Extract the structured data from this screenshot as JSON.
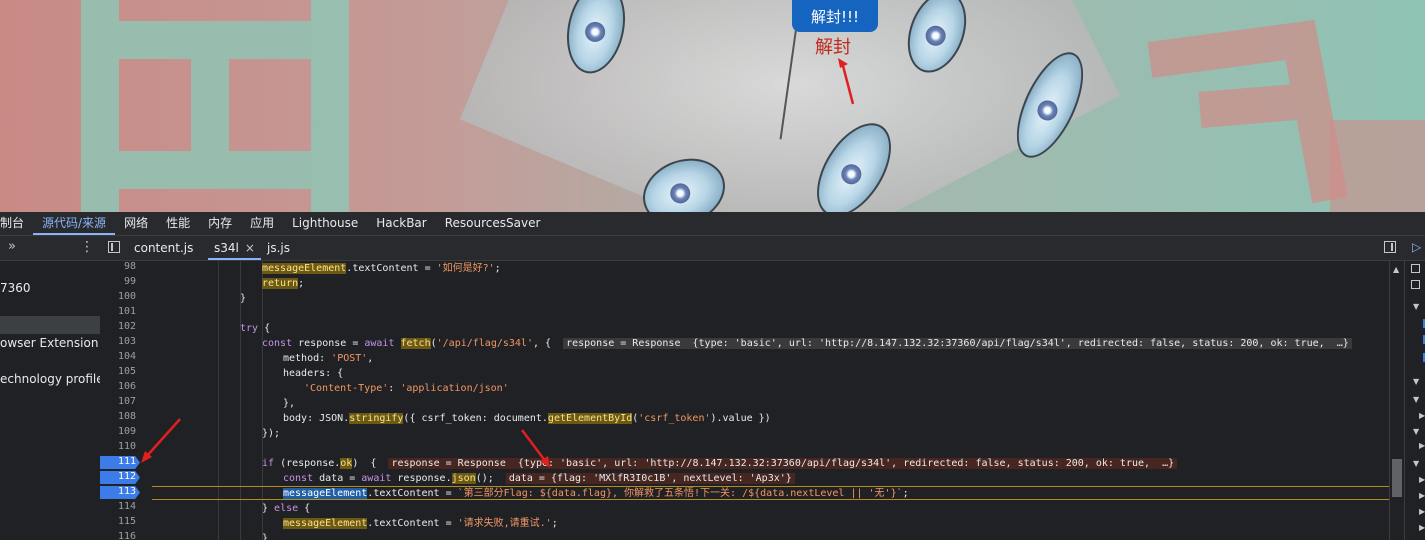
{
  "webpage": {
    "button_label": "解封!!!",
    "unseal_text": "解封"
  },
  "devtools": {
    "panel_tabs": [
      "制台",
      "源代码/来源",
      "网络",
      "性能",
      "内存",
      "应用",
      "Lighthouse",
      "HackBar",
      "ResourcesSaver"
    ],
    "active_panel_tab": "源代码/来源",
    "more_tabs_glyph": "»",
    "kebab_glyph": "⋮",
    "file_tabs": [
      "content.js",
      "s34l",
      "js.js"
    ],
    "active_file_tab": "s34l",
    "close_glyph": "×",
    "navigator_items": [
      "7360",
      "owser Extension",
      "echnology profiler"
    ],
    "line_numbers": [
      "98",
      "99",
      "100",
      "101",
      "102",
      "103",
      "104",
      "105",
      "106",
      "107",
      "108",
      "109",
      "110",
      "111",
      "112",
      "113",
      "114",
      "115",
      "116"
    ],
    "breakpoint_lines": [
      "111",
      "112",
      "113"
    ],
    "code": {
      "l98_a": "messageElement",
      "l98_b": ".textContent = ",
      "l98_c": "'如何是好?'",
      "l98_d": ";",
      "l99_a": "return",
      "l99_b": ";",
      "l100": "}",
      "l102_a": "try",
      "l102_b": " {",
      "l103_a": "const",
      "l103_b": " response = ",
      "l103_c": "await",
      "l103_d": " ",
      "l103_e": "fetch",
      "l103_f": "(",
      "l103_g": "'/api/flag/s34l'",
      "l103_h": ", {  ",
      "l103_i": "response = Response  {type: 'basic', url: 'http://8.147.132.32:37360/api/flag/s34l', redirected: false, status: 200, ok: true,  …}",
      "l104_a": "method: ",
      "l104_b": "'POST'",
      "l104_c": ",",
      "l105": "headers: {",
      "l106_a": "'Content-Type'",
      "l106_b": ": ",
      "l106_c": "'application/json'",
      "l107": "},",
      "l108_a": "body: JSON.",
      "l108_b": "stringify",
      "l108_c": "({ csrf_token: document.",
      "l108_d": "getElementById",
      "l108_e": "(",
      "l108_f": "'csrf_token'",
      "l108_g": ").value })",
      "l109": "});",
      "l111_a": "if",
      "l111_b": " (response.",
      "l111_c": "ok",
      "l111_d": ")  {  ",
      "l111_e": "response = Response  {type: 'basic', url: 'http://8.147.132.32:37360/api/flag/s34l', redirected: false, status: 200, ok: true,  …}",
      "l112_a": "const",
      "l112_b": " data = ",
      "l112_c": "await",
      "l112_d": " response.",
      "l112_e": "json",
      "l112_f": "();  ",
      "l112_g": "data = {flag: 'MXlfR3I0c1B', nextLevel: 'Ap3x'}",
      "l113_a": "messageElement",
      "l113_b": ".textContent = ",
      "l113_c": "`第三部分Flag: ${data.flag}, 你解救了五条悟!下一关: /${data.nextLevel || '无'}`",
      "l113_d": ";",
      "l114_a": "} ",
      "l114_b": "else",
      "l114_c": " {",
      "l115_a": "messageElement",
      "l115_b": ".textContent = ",
      "l115_c": "'请求失败,请重试.'",
      "l115_d": ";",
      "l116": "}"
    }
  },
  "colors": {
    "accent": "#8ab4f8",
    "breakpoint": "#3b7ce8",
    "button": "#1565c0",
    "unseal_text": "#c0291d",
    "arrow": "#e02020"
  }
}
